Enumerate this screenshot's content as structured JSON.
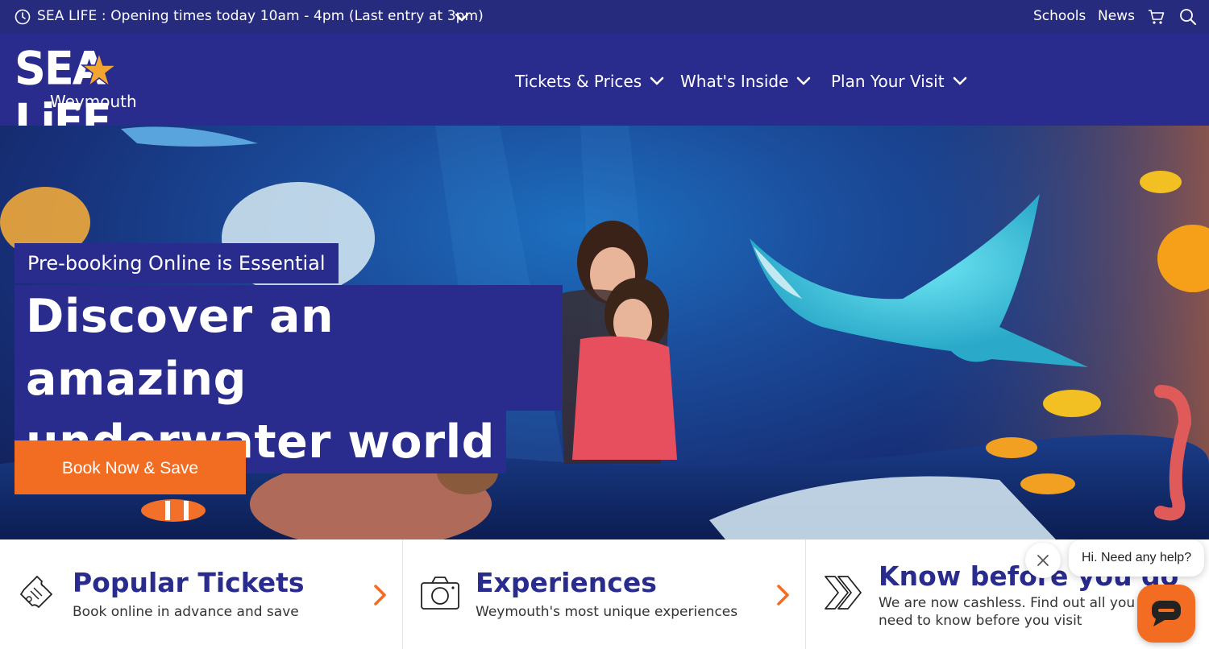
{
  "topbar": {
    "opening_text": "SEA LIFE : Opening times today 10am - 4pm (Last entry at 3pm)",
    "links": [
      "Schools",
      "News"
    ],
    "icons": [
      "clock-icon",
      "chevron-down-icon",
      "cart-icon",
      "search-icon"
    ]
  },
  "header": {
    "logo_text": "SEA LiFE",
    "logo_location": "Weymouth",
    "nav": [
      "Tickets & Prices",
      "What's Inside",
      "Plan Your Visit"
    ]
  },
  "hero": {
    "eyebrow": "Pre-booking Online is Essential",
    "headline_line1": "Discover an amazing",
    "headline_line2": "underwater world",
    "cta": "Book Now & Save"
  },
  "cards": [
    {
      "title": "Popular Tickets",
      "desc": "Book online in advance and save",
      "icon": "ticket-icon"
    },
    {
      "title": "Experiences",
      "desc": "Weymouth's most unique experiences",
      "icon": "camera-icon"
    },
    {
      "title": "Know before you go",
      "desc": "We are now cashless. Find out all you need to know before you visit",
      "icon": "double-chevron-icon"
    }
  ],
  "chat": {
    "prompt": "Hi. Need any help?",
    "icons": [
      "close-icon",
      "chat-icon"
    ]
  },
  "colors": {
    "navy": "#292b8d",
    "topbar": "#272b7e",
    "orange": "#f26d21"
  }
}
